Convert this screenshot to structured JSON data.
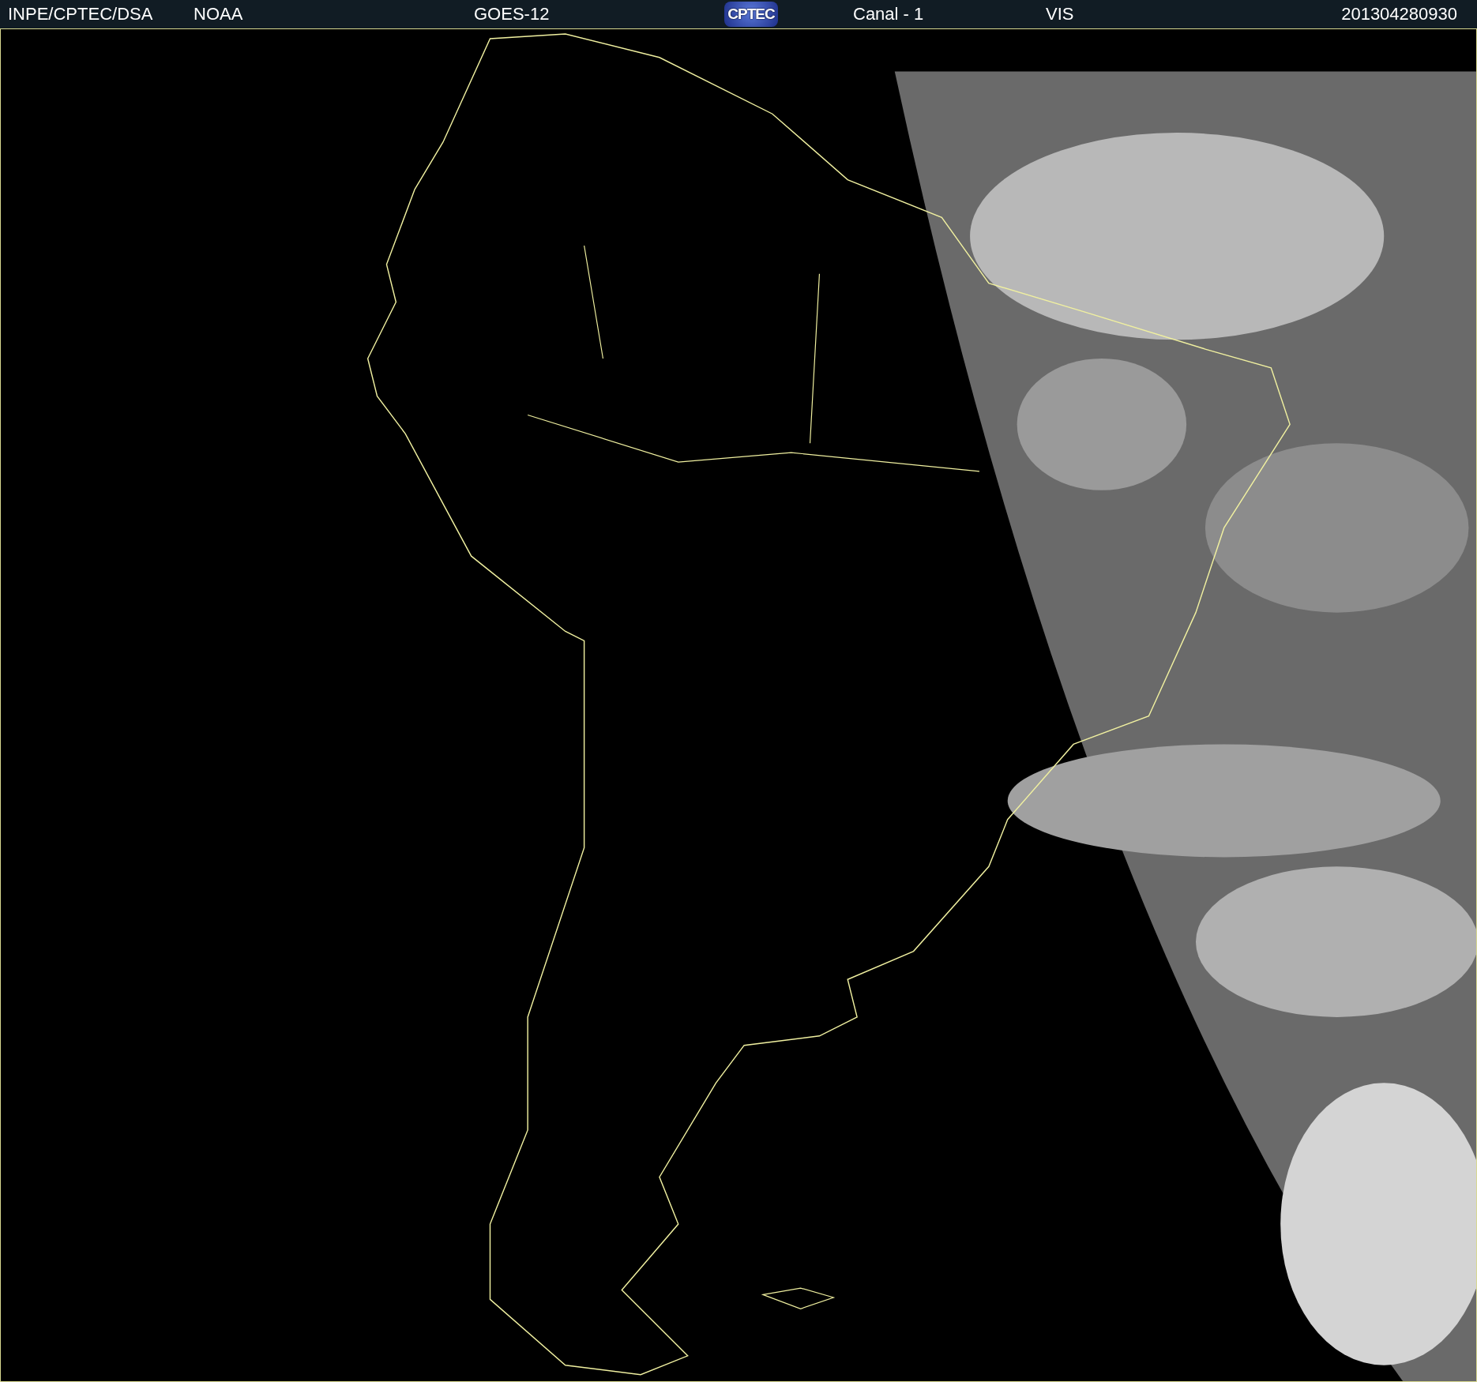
{
  "header": {
    "source": "INPE/CPTEC/DSA",
    "agency": "NOAA",
    "satellite": "GOES-12",
    "logo": "CPTEC",
    "channel": "Canal - 1",
    "band": "VIS",
    "timestamp": "201304280930"
  }
}
